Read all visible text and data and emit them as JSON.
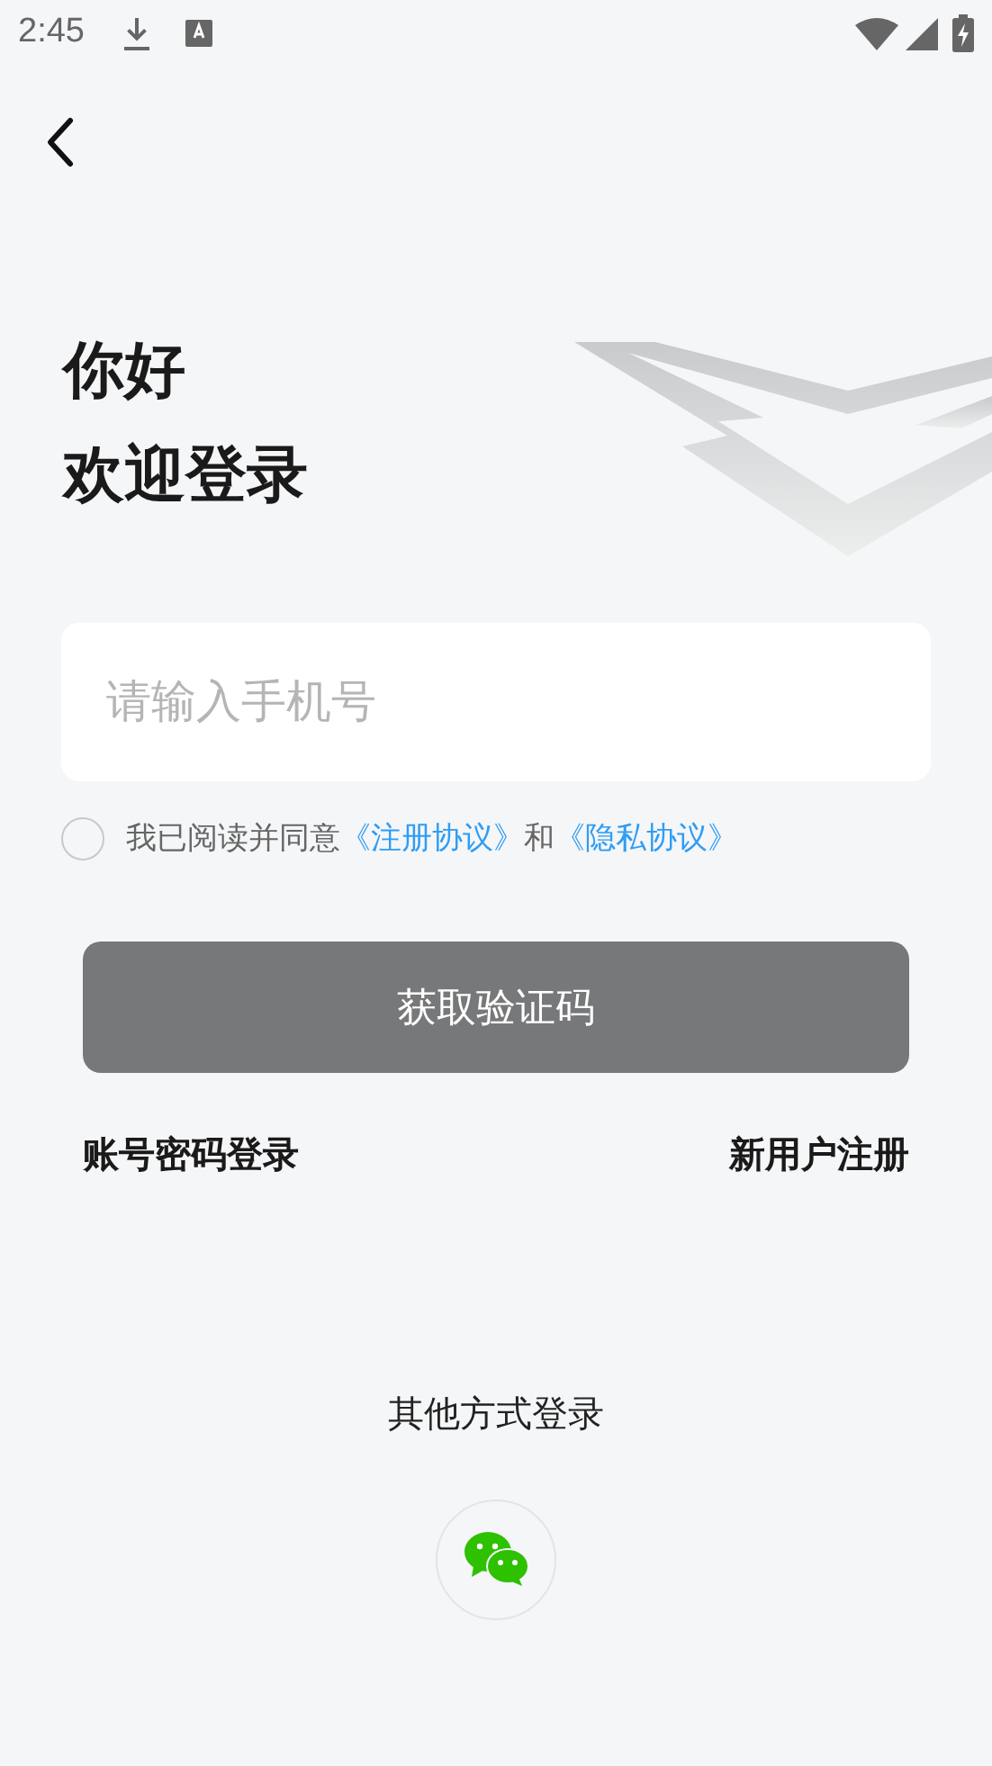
{
  "status_bar": {
    "time": "2:45"
  },
  "greeting": [
    "你好",
    "欢迎登录"
  ],
  "phone_field": {
    "placeholder": "请输入手机号"
  },
  "agreement": {
    "checked": false,
    "prefix": "我已阅读并同意",
    "links": [
      "《注册协议》",
      "《隐私协议》"
    ],
    "joiner": "和"
  },
  "submit_button": {
    "label": "获取验证码",
    "disabled": true
  },
  "secondary_links": [
    "账号密码登录",
    "新用户注册"
  ],
  "other_login": {
    "title": "其他方式登录"
  }
}
